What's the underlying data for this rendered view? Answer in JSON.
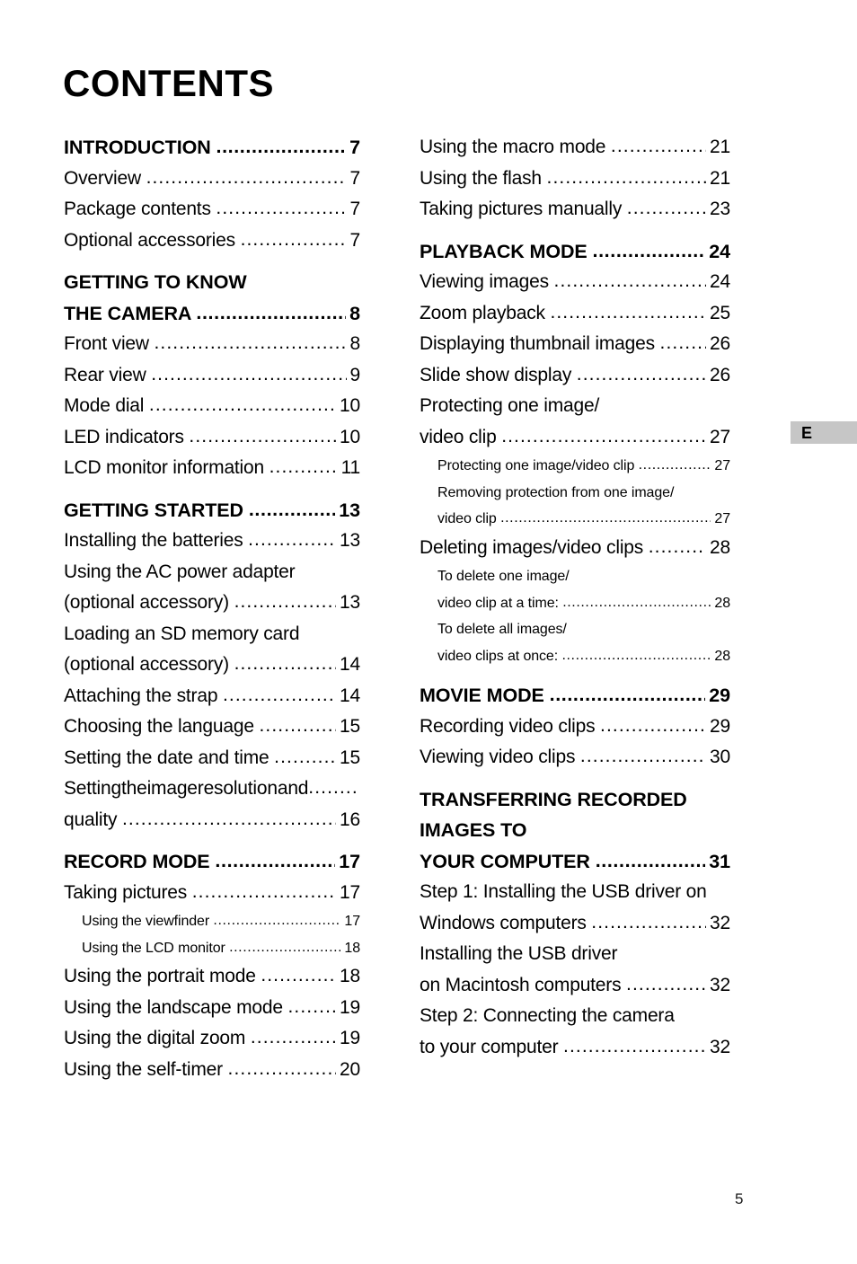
{
  "document": {
    "title": "CONTENTS",
    "page_number": "5",
    "side_tab_label": "E"
  },
  "toc": {
    "left_column": [
      {
        "level": 1,
        "label": "INTRODUCTION",
        "page": "7"
      },
      {
        "level": 2,
        "label": "Overview",
        "page": "7"
      },
      {
        "level": 2,
        "label": "Package contents",
        "page": "7"
      },
      {
        "level": 2,
        "label": "Optional accessories",
        "page": "7"
      },
      {
        "level": 1,
        "label": "GETTING TO KNOW",
        "page": "",
        "wrap": true
      },
      {
        "level": 1,
        "label": "THE CAMERA",
        "page": "8",
        "cont": true
      },
      {
        "level": 2,
        "label": "Front view",
        "page": "8"
      },
      {
        "level": 2,
        "label": "Rear view",
        "page": "9"
      },
      {
        "level": 2,
        "label": "Mode dial",
        "page": "10"
      },
      {
        "level": 2,
        "label": "LED indicators",
        "page": "10"
      },
      {
        "level": 2,
        "label": "LCD monitor information",
        "page": "11"
      },
      {
        "level": 1,
        "label": "GETTING STARTED",
        "page": "13"
      },
      {
        "level": 2,
        "label": "Installing the batteries",
        "page": "13"
      },
      {
        "level": 2,
        "label": "Using the AC power adapter",
        "page": "",
        "wrap": true
      },
      {
        "level": 2,
        "label": "(optional accessory)",
        "page": "13"
      },
      {
        "level": 2,
        "label": "Loading an SD memory card",
        "page": "",
        "wrap": true
      },
      {
        "level": 2,
        "label": "(optional accessory)",
        "page": "14"
      },
      {
        "level": 2,
        "label": "Attaching the strap",
        "page": "14"
      },
      {
        "level": 2,
        "label": "Choosing the language",
        "page": "15"
      },
      {
        "level": 2,
        "label": "Setting the date and time",
        "page": "15"
      },
      {
        "level": 2,
        "label": "Setting the image resolution and",
        "page": "",
        "justify": true
      },
      {
        "level": 2,
        "label": "quality",
        "page": "16"
      },
      {
        "level": 1,
        "label": "RECORD MODE",
        "page": "17"
      },
      {
        "level": 2,
        "label": "Taking pictures",
        "page": "17"
      },
      {
        "level": 3,
        "label": "Using the viewfinder",
        "page": "17"
      },
      {
        "level": 3,
        "label": "Using the LCD monitor",
        "page": "18"
      },
      {
        "level": 2,
        "label": "Using the portrait mode",
        "page": "18"
      },
      {
        "level": 2,
        "label": "Using the landscape mode",
        "page": "19"
      },
      {
        "level": 2,
        "label": "Using the digital zoom",
        "page": "19"
      },
      {
        "level": 2,
        "label": "Using the self-timer",
        "page": "20"
      }
    ],
    "right_column": [
      {
        "level": 2,
        "label": "Using the macro mode",
        "page": "21"
      },
      {
        "level": 2,
        "label": "Using the flash",
        "page": "21"
      },
      {
        "level": 2,
        "label": "Taking pictures manually",
        "page": "23"
      },
      {
        "level": 1,
        "label": "PLAYBACK MODE",
        "page": "24"
      },
      {
        "level": 2,
        "label": "Viewing images",
        "page": "24"
      },
      {
        "level": 2,
        "label": "Zoom playback",
        "page": "25"
      },
      {
        "level": 2,
        "label": "Displaying thumbnail images",
        "page": "26"
      },
      {
        "level": 2,
        "label": "Slide show display",
        "page": "26"
      },
      {
        "level": 2,
        "label": "Protecting one image/",
        "page": "",
        "wrap": true
      },
      {
        "level": 2,
        "label": "video clip",
        "page": "27"
      },
      {
        "level": 3,
        "label": "Protecting one image/video clip",
        "page": "27"
      },
      {
        "level": 3,
        "label": "Removing protection from one image/",
        "page": "",
        "wrap": true
      },
      {
        "level": 3,
        "label": "video clip",
        "page": "27"
      },
      {
        "level": 2,
        "label": "Deleting images/video clips",
        "page": "28"
      },
      {
        "level": 3,
        "label": "To delete one image/",
        "page": "",
        "wrap": true
      },
      {
        "level": 3,
        "label": "video clip at a time:",
        "page": "28"
      },
      {
        "level": 3,
        "label": "To delete all images/",
        "page": "",
        "wrap": true
      },
      {
        "level": 3,
        "label": "video clips at once:",
        "page": "28"
      },
      {
        "level": 1,
        "label": "MOVIE MODE",
        "page": "29"
      },
      {
        "level": 2,
        "label": "Recording video clips",
        "page": "29"
      },
      {
        "level": 2,
        "label": "Viewing video clips",
        "page": "30"
      },
      {
        "level": 1,
        "label": "TRANSFERRING RECORDED",
        "page": "",
        "wrap": true
      },
      {
        "level": 1,
        "label": "IMAGES TO",
        "page": "",
        "wrap": true,
        "cont": true
      },
      {
        "level": 1,
        "label": "YOUR COMPUTER",
        "page": "31",
        "cont": true
      },
      {
        "level": 2,
        "label": "Step 1: Installing the USB driver on",
        "page": "",
        "wrap": true
      },
      {
        "level": 2,
        "label": "Windows computers",
        "page": "32"
      },
      {
        "level": 2,
        "label": "Installing the USB driver",
        "page": "",
        "wrap": true
      },
      {
        "level": 2,
        "label": "on Macintosh computers",
        "page": "32"
      },
      {
        "level": 2,
        "label": "Step 2: Connecting the camera",
        "page": "",
        "wrap": true
      },
      {
        "level": 2,
        "label": "to your computer",
        "page": "32"
      }
    ]
  }
}
